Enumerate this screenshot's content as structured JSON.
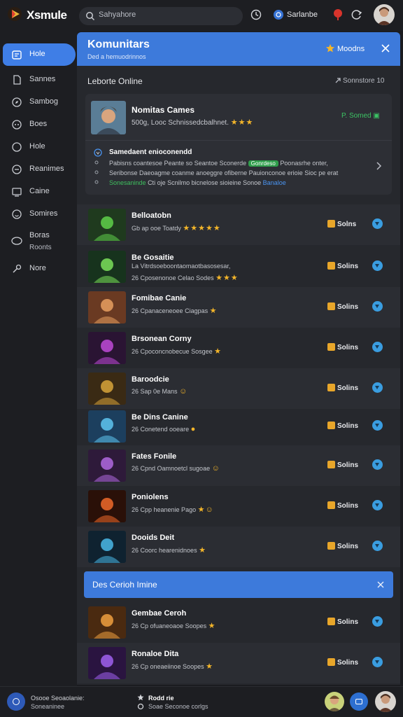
{
  "app": {
    "brand": "Xsmule"
  },
  "search": {
    "placeholder": "Sahyahore"
  },
  "topbar": {
    "lang_label": "Sarlanbe"
  },
  "sidebar": {
    "items": [
      {
        "label": "Hole",
        "icon": "home-icon",
        "active": true
      },
      {
        "label": "Sannes",
        "icon": "document-icon"
      },
      {
        "label": "Sambog",
        "icon": "compass-icon"
      },
      {
        "label": "Boes",
        "icon": "gamepad-icon"
      },
      {
        "label": "Hole",
        "icon": "circle-icon"
      },
      {
        "label": "Reanimes",
        "icon": "chat-icon"
      },
      {
        "label": "Caine",
        "icon": "monitor-icon"
      },
      {
        "label": "Somires",
        "icon": "smile-icon"
      },
      {
        "label": "Boras",
        "label2": "Roonts",
        "icon": "ring-icon"
      },
      {
        "label": "Nore",
        "icon": "wrench-icon"
      }
    ]
  },
  "panel": {
    "title": "Komunitars",
    "subtitle": "Ded a hemuodrinnos",
    "badge": "Moodns",
    "section_title": "Leborte Online",
    "section_link": "Sonnstore 10"
  },
  "feature": {
    "title": "Nomitas Cames",
    "meta": "500g, Looc Schnissedcbalhnet.",
    "stars": "★★★",
    "status": "P. Somed ▣",
    "notice": {
      "title": "Samedaent enioconendd",
      "line1_a": "Pabisns coantesoe Peante so Seantoe Sconerde",
      "line1_tag": "Gonrdeso",
      "line1_b": "Poonasrhe onter,",
      "line2": "Seribonse Daeoagme coanme anoeggre ofiberne Pauionconoe erioie Sioc pe erat",
      "line3_a": "Sonesaninde",
      "line3_b": "Cti oje Scnilmo bicnelose sioieine Sonoe",
      "line3_c": "Banaloe"
    }
  },
  "games": [
    {
      "title": "Belloatobn",
      "sub": "Gb ap ooe Toatdy",
      "stars": "★★★★★",
      "count": "Solns"
    },
    {
      "title": "Be Gosaitie",
      "sub": "La Vitrdsoeboontaomaotbasosesar,",
      "sub2": "26 Cposenonoe Celao Sodes",
      "stars": "★★★",
      "count": "Solins"
    },
    {
      "title": "Fomibae Canie",
      "sub": "26 Cpanaceneoee Ciagpas",
      "stars": "★",
      "count": "Solins"
    },
    {
      "title": "Brsonean Corny",
      "sub": "26 Cpoconcnobecue Sosgee",
      "stars": "★",
      "count": "Solins"
    },
    {
      "title": "Baroodcie",
      "sub": "26 Sap 0e Mans",
      "stars": "☺",
      "count": "Solins"
    },
    {
      "title": "Be Dins Canine",
      "sub": "26 Conetend ooeare",
      "stars": "●",
      "count": "Solins"
    },
    {
      "title": "Fates Fonile",
      "sub": "26 Cpnd Oamnoetcl sugoae",
      "stars": "☺",
      "count": "Solins"
    },
    {
      "title": "Poniolens",
      "sub": "26 Cpp heanenie Pago",
      "stars": "★☺",
      "count": "Solins"
    },
    {
      "title": "Dooids Deit",
      "sub": "26 Coorc hearenidnoes",
      "stars": "★",
      "count": "Solins"
    },
    {
      "title": "Gembae Ceroh",
      "sub": "26 Cp ofuaneoaoe Soopes",
      "stars": "★",
      "count": "Solins"
    },
    {
      "title": "Ronaloe Dita",
      "sub": "26 Cp oneaeiinoe Soopes",
      "stars": "★",
      "count": "Solins"
    }
  ],
  "banner": {
    "text": "Des Cerioh Imine"
  },
  "bottombar": {
    "left1": "Osooe Seoaolanie:",
    "left2": "Soneaninee",
    "mid1": "Rodd rie",
    "mid2": "Soae Seconoe corlgs"
  },
  "colors": {
    "accent": "#3d7adb",
    "star": "#f3b52a",
    "online": "#3cc464"
  }
}
